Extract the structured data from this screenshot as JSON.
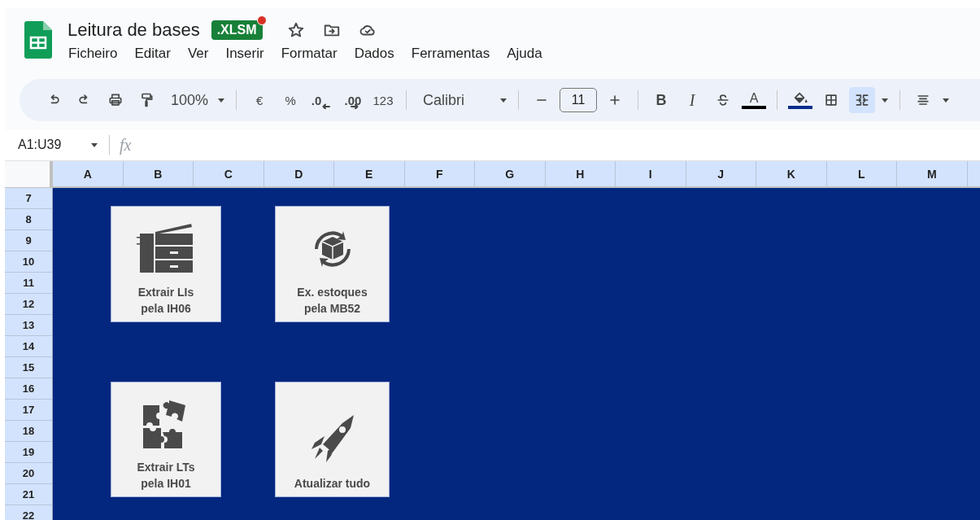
{
  "document": {
    "title": "Leitura de bases",
    "badge": ".XLSM",
    "badge_notification": true
  },
  "menu": [
    "Ficheiro",
    "Editar",
    "Ver",
    "Inserir",
    "Formatar",
    "Dados",
    "Ferramentas",
    "Ajuda"
  ],
  "toolbar": {
    "zoom": "100%",
    "currency": "€",
    "percent": "%",
    "decrease_decimals": ".0",
    "increase_decimals": ".00",
    "number_format": "123",
    "font": "Calibri",
    "font_size": "11",
    "bold": "B",
    "italic": "I",
    "text_color_letter": "A",
    "merge_selected": true
  },
  "formula_bar": {
    "name_box": "A1:U39",
    "fx": "fx"
  },
  "columns": [
    "A",
    "B",
    "C",
    "D",
    "E",
    "F",
    "G",
    "H",
    "I",
    "J",
    "K",
    "L",
    "M"
  ],
  "rows": [
    "7",
    "8",
    "9",
    "10",
    "11",
    "12",
    "13",
    "14",
    "15",
    "16",
    "17",
    "18",
    "19",
    "20",
    "21",
    "22"
  ],
  "buttons": [
    {
      "kind": "copier",
      "lines": [
        "Extrair LIs",
        "pela IH06"
      ]
    },
    {
      "kind": "box-cycle",
      "lines": [
        "Ex. estoques",
        "pela MB52"
      ]
    },
    {
      "kind": "puzzle",
      "lines": [
        "Extrair LTs",
        "pela IH01"
      ]
    },
    {
      "kind": "rocket",
      "lines": [
        "Atualizar tudo"
      ]
    }
  ]
}
